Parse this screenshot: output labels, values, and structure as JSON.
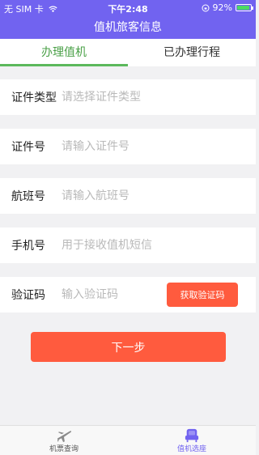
{
  "status_bar": {
    "carrier": "无 SIM 卡",
    "time": "下午2:48",
    "battery": "92%",
    "battery_level": 0.92
  },
  "nav": {
    "title": "值机旅客信息"
  },
  "tabs": [
    {
      "label": "办理值机",
      "active": true
    },
    {
      "label": "已办理行程",
      "active": false
    }
  ],
  "form": {
    "id_type": {
      "label": "证件类型",
      "placeholder": "请选择证件类型"
    },
    "id_number": {
      "label": "证件号",
      "placeholder": "请输入证件号"
    },
    "flight_number": {
      "label": "航班号",
      "placeholder": "请输入航班号"
    },
    "phone": {
      "label": "手机号",
      "placeholder": "用于接收值机短信"
    },
    "code": {
      "label": "验证码",
      "placeholder": "输入验证码",
      "button_label": "获取验证码"
    }
  },
  "next_button": {
    "label": "下一步"
  },
  "tabbar": [
    {
      "label": "机票查询",
      "icon": "airplane-icon",
      "active": false
    },
    {
      "label": "值机选座",
      "icon": "seat-icon",
      "active": true
    }
  ],
  "colors": {
    "header": "#7163f0",
    "active_tab": "#4aa047",
    "button": "#ff5b3e",
    "tabbar_active": "#7163f0"
  }
}
